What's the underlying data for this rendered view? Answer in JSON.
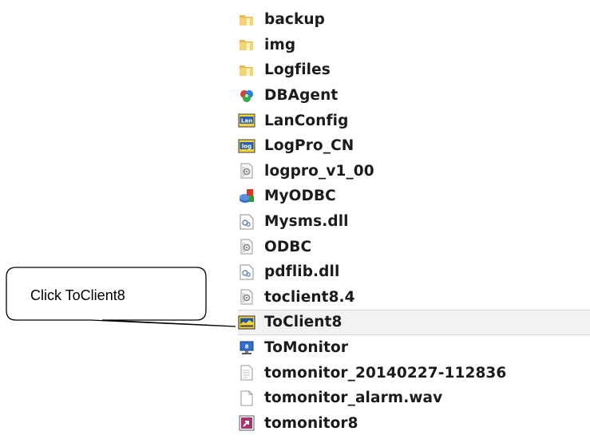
{
  "callout": {
    "text": "Click ToClient8"
  },
  "files": [
    {
      "label": "backup",
      "icon": "folder-icon"
    },
    {
      "label": "img",
      "icon": "folder-icon"
    },
    {
      "label": "Logfiles",
      "icon": "folder-icon"
    },
    {
      "label": "DBAgent",
      "icon": "dbagent-app-icon"
    },
    {
      "label": "LanConfig",
      "icon": "lanconfig-app-icon"
    },
    {
      "label": "LogPro_CN",
      "icon": "logpro-app-icon"
    },
    {
      "label": "logpro_v1_00",
      "icon": "config-file-icon"
    },
    {
      "label": "MyODBC",
      "icon": "myodbc-app-icon"
    },
    {
      "label": "Mysms.dll",
      "icon": "dll-file-icon"
    },
    {
      "label": "ODBC",
      "icon": "config-file-icon"
    },
    {
      "label": "pdflib.dll",
      "icon": "dll-file-icon"
    },
    {
      "label": "toclient8.4",
      "icon": "config-file-icon"
    },
    {
      "label": "ToClient8",
      "icon": "toclient-app-icon",
      "highlighted": true
    },
    {
      "label": "ToMonitor",
      "icon": "monitor-app-icon"
    },
    {
      "label": "tomonitor_20140227-112836",
      "icon": "text-file-icon"
    },
    {
      "label": "tomonitor_alarm.wav",
      "icon": "blank-file-icon"
    },
    {
      "label": "tomonitor8",
      "icon": "shortcut-app-icon"
    }
  ],
  "colors": {
    "folder": "#e8c35a",
    "highlight_bg": "#f2f2f2",
    "highlight_border": "#d9d9d9",
    "callout_stroke": "#000000"
  }
}
